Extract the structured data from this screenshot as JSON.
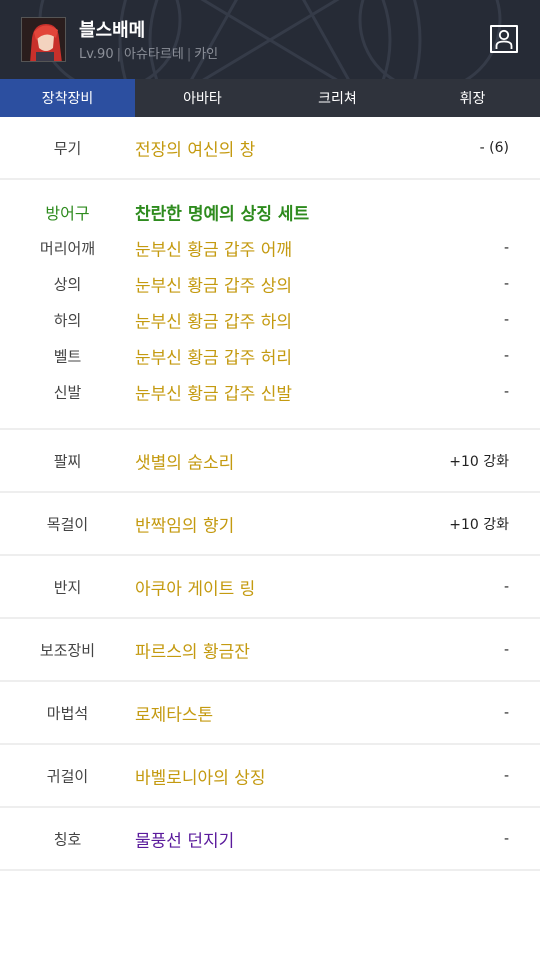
{
  "header": {
    "character_name": "블스배메",
    "level": "Lv.90",
    "job": "아슈타르테",
    "server": "카인",
    "icons": {
      "avatar": "character-portrait",
      "profile": "person-icon"
    },
    "colors": {
      "background": "#262b36",
      "name": "#ffffff",
      "info": "#8b8f98"
    }
  },
  "tabs": [
    {
      "label": "장착장비",
      "active": true
    },
    {
      "label": "아바타",
      "active": false
    },
    {
      "label": "크리쳐",
      "active": false
    },
    {
      "label": "휘장",
      "active": false
    }
  ],
  "equipment": {
    "weapon": {
      "slot": "무기",
      "name": "전장의 여신의 창",
      "value": "- (6)"
    },
    "armor": {
      "set_label": "방어구",
      "set_name": "찬란한 명예의 상징 세트",
      "items": [
        {
          "slot": "머리어깨",
          "name": "눈부신 황금 갑주 어깨",
          "value": "-"
        },
        {
          "slot": "상의",
          "name": "눈부신 황금 갑주 상의",
          "value": "-"
        },
        {
          "slot": "하의",
          "name": "눈부신 황금 갑주 하의",
          "value": "-"
        },
        {
          "slot": "벨트",
          "name": "눈부신 황금 갑주 허리",
          "value": "-"
        },
        {
          "slot": "신발",
          "name": "눈부신 황금 갑주 신발",
          "value": "-"
        }
      ]
    },
    "accessories": [
      {
        "slot": "팔찌",
        "name": "샛별의 숨소리",
        "value": "+10 강화"
      },
      {
        "slot": "목걸이",
        "name": "반짝임의 향기",
        "value": "+10 강화"
      },
      {
        "slot": "반지",
        "name": "아쿠아 게이트 링",
        "value": "-"
      },
      {
        "slot": "보조장비",
        "name": "파르스의 황금잔",
        "value": "-"
      },
      {
        "slot": "마법석",
        "name": "로제타스톤",
        "value": "-"
      },
      {
        "slot": "귀걸이",
        "name": "바벨로니아의 상징",
        "value": "-"
      },
      {
        "slot": "칭호",
        "name": "물풍선 던지기",
        "value": "-"
      }
    ]
  },
  "colors": {
    "tab_active": "#2c4fa0",
    "tab_bar": "#2f333c",
    "item_gold": "#c49a10",
    "set_green": "#2e8b1e",
    "title_purple": "#5a1a9c"
  }
}
